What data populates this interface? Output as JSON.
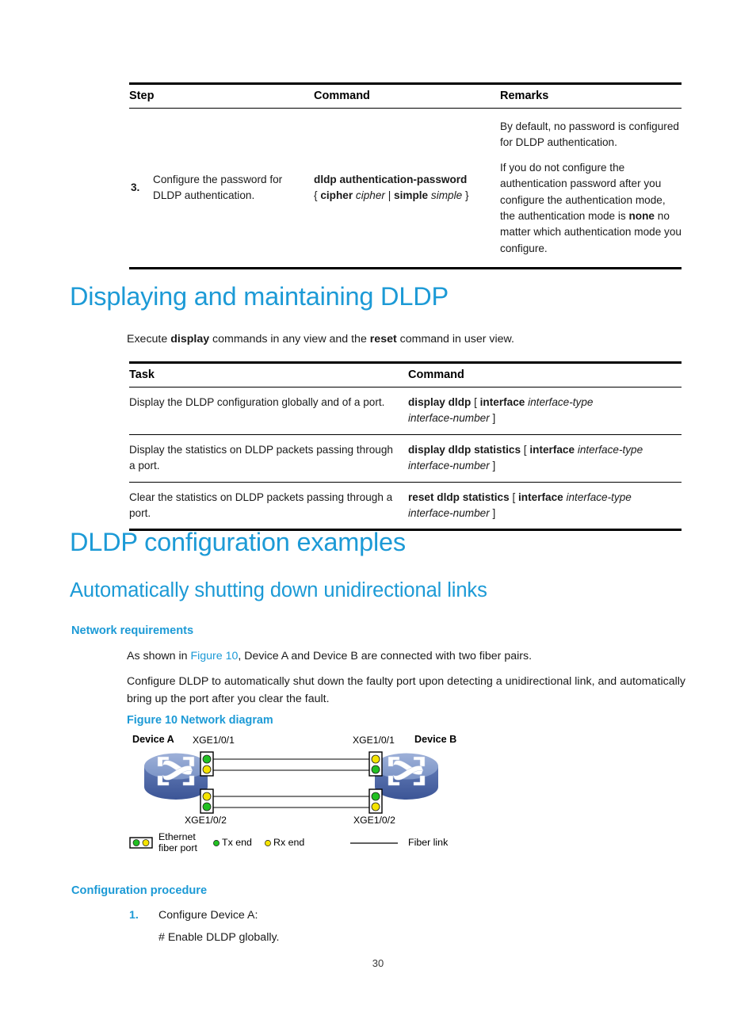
{
  "table1": {
    "headers": [
      "Step",
      "Command",
      "Remarks"
    ],
    "rows": [
      {
        "num": "3.",
        "step": "Configure the password for DLDP authentication.",
        "command_bold_1": "dldp authentication-password",
        "command_line2_parts": [
          {
            "t": "{ ",
            "s": "plain"
          },
          {
            "t": "cipher",
            "s": "bold"
          },
          {
            "t": " ",
            "s": "plain"
          },
          {
            "t": "cipher",
            "s": "italic"
          },
          {
            "t": " | ",
            "s": "plain"
          },
          {
            "t": "simple",
            "s": "bold"
          },
          {
            "t": " ",
            "s": "plain"
          },
          {
            "t": "simple",
            "s": "italic"
          },
          {
            "t": " }",
            "s": "plain"
          }
        ],
        "remark_1": "By default, no password is configured for DLDP authentication.",
        "remark_2_pre": "If you do not configure the authentication password after you configure the authentication mode, the authentication mode is ",
        "remark_2_bold": "none",
        "remark_2_post": " no matter which authentication mode you configure."
      }
    ]
  },
  "section_display": {
    "heading": "Displaying and maintaining DLDP",
    "intro_pre": "Execute ",
    "intro_bold1": "display",
    "intro_mid": " commands in any view and the ",
    "intro_bold2": "reset",
    "intro_post": " command in user view."
  },
  "table2": {
    "headers": [
      "Task",
      "Command"
    ],
    "rows": [
      {
        "task": "Display the DLDP configuration globally and of a port.",
        "cmd_bold": "display dldp",
        "cmd_rest_1_pre": " [ ",
        "cmd_rest_1_bold": "interface",
        "cmd_rest_1_ital": " interface-type",
        "cmd_line2_ital": "interface-number",
        "cmd_line2_post": " ]"
      },
      {
        "task": "Display the statistics on DLDP packets passing through a port.",
        "cmd_bold": "display dldp statistics",
        "cmd_rest_1_pre": " [ ",
        "cmd_rest_1_bold": "interface",
        "cmd_rest_1_ital": " interface-type",
        "cmd_line2_ital": "interface-number",
        "cmd_line2_post": " ]"
      },
      {
        "task": "Clear the statistics on DLDP packets passing through a port.",
        "cmd_bold": "reset dldp statistics",
        "cmd_rest_1_pre": " [ ",
        "cmd_rest_1_bold": "interface",
        "cmd_rest_1_ital": " interface-type",
        "cmd_line2_ital": "interface-number",
        "cmd_line2_post": " ]"
      }
    ]
  },
  "section_examples": {
    "heading": "DLDP configuration examples",
    "sub_heading": "Automatically shutting down unidirectional links",
    "network_req_heading": "Network requirements",
    "para1_pre": "As shown in ",
    "para1_link": "Figure 10",
    "para1_post": ", Device A and Device B are connected with two fiber pairs.",
    "para2": "Configure DLDP to automatically shut down the faulty port upon detecting a unidirectional link, and automatically bring up the port after you clear the fault.",
    "figure_caption": "Figure 10 Network diagram"
  },
  "diagram": {
    "device_a_label": "Device A",
    "device_b_label": "Device B",
    "port_a_top": "XGE1/0/1",
    "port_b_top": "XGE1/0/1",
    "port_a_bottom": "XGE1/0/2",
    "port_b_bottom": "XGE1/0/2",
    "leds": {
      "a_top": [
        "green",
        "yellow"
      ],
      "b_top": [
        "yellow",
        "green"
      ],
      "a_bottom": [
        "yellow",
        "green"
      ],
      "b_bottom": [
        "green",
        "yellow"
      ]
    },
    "legend": {
      "eth_port_line1": "Ethernet",
      "eth_port_line2": "fiber port",
      "tx_end": "Tx end",
      "rx_end": "Rx end",
      "fiber_link": "Fiber link"
    },
    "colors": {
      "green": "#22c022",
      "yellow": "#f5e400",
      "device_top": "#8ea5d2",
      "device_side": "#4a63a8",
      "line": "#000000"
    }
  },
  "section_procedure": {
    "heading": "Configuration procedure",
    "item_num": "1.",
    "item_text": "Configure Device A:",
    "item_sub": "# Enable DLDP globally."
  },
  "footer": {
    "page_number": "30"
  },
  "theme": {
    "accent": "#1c9ad6"
  }
}
